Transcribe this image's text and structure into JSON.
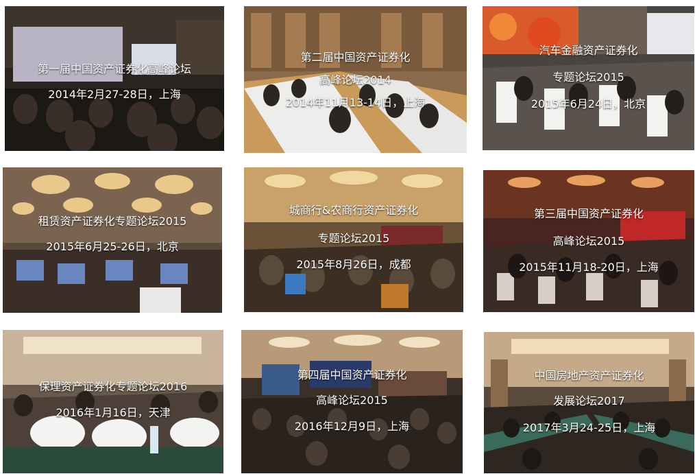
{
  "events": [
    {
      "lines": [
        "第一届中国资产证券化高峰论坛",
        "2014年2月27-28日，上海"
      ]
    },
    {
      "lines": [
        "第二届中国资产证券化",
        "高峰论坛2014",
        "2014年11月13-14日，上海"
      ]
    },
    {
      "lines": [
        "汽车金融资产证券化",
        "专题论坛2015",
        "2015年6月24日，北京"
      ]
    },
    {
      "lines": [
        "租赁资产证券化专题论坛2015",
        "2015年6月25-26日，北京"
      ]
    },
    {
      "lines": [
        "城商行&农商行资产证券化",
        "专题论坛2015",
        "2015年8月26日，成都"
      ]
    },
    {
      "lines": [
        "第三届中国资产证券化",
        "高峰论坛2015",
        "2015年11月18-20日，上海"
      ]
    },
    {
      "lines": [
        "保理资产证券化专题论坛2016",
        "2016年1月16日，天津"
      ]
    },
    {
      "lines": [
        "第四届中国资产证券化",
        "高峰论坛2015",
        "2016年12月9日，上海"
      ]
    },
    {
      "lines": [
        "中国房地产资产证券化",
        "发展论坛2017",
        "2017年3月24-25日，上海"
      ]
    }
  ]
}
